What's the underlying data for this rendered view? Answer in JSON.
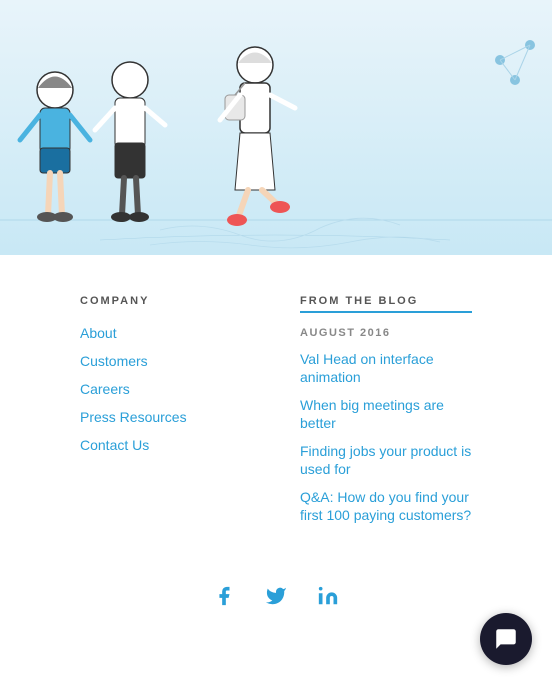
{
  "hero": {
    "background_color": "#d4edf7"
  },
  "company": {
    "section_title": "COMPANY",
    "links": [
      {
        "label": "About",
        "href": "#"
      },
      {
        "label": "Customers",
        "href": "#"
      },
      {
        "label": "Careers",
        "href": "#"
      },
      {
        "label": "Press Resources",
        "href": "#"
      },
      {
        "label": "Contact Us",
        "href": "#"
      }
    ]
  },
  "blog": {
    "section_title": "FROM THE BLOG",
    "date_label": "AUGUST 2016",
    "posts": [
      {
        "label": "Val Head on interface animation"
      },
      {
        "label": "When big meetings are better"
      },
      {
        "label": "Finding jobs your product is used for"
      },
      {
        "label": "Q&A: How do you find your first 100 paying customers?"
      }
    ]
  },
  "social": {
    "icons": [
      {
        "name": "facebook",
        "symbol": "f"
      },
      {
        "name": "twitter",
        "symbol": "t"
      },
      {
        "name": "linkedin",
        "symbol": "in"
      }
    ]
  },
  "chat": {
    "label": "Chat"
  }
}
